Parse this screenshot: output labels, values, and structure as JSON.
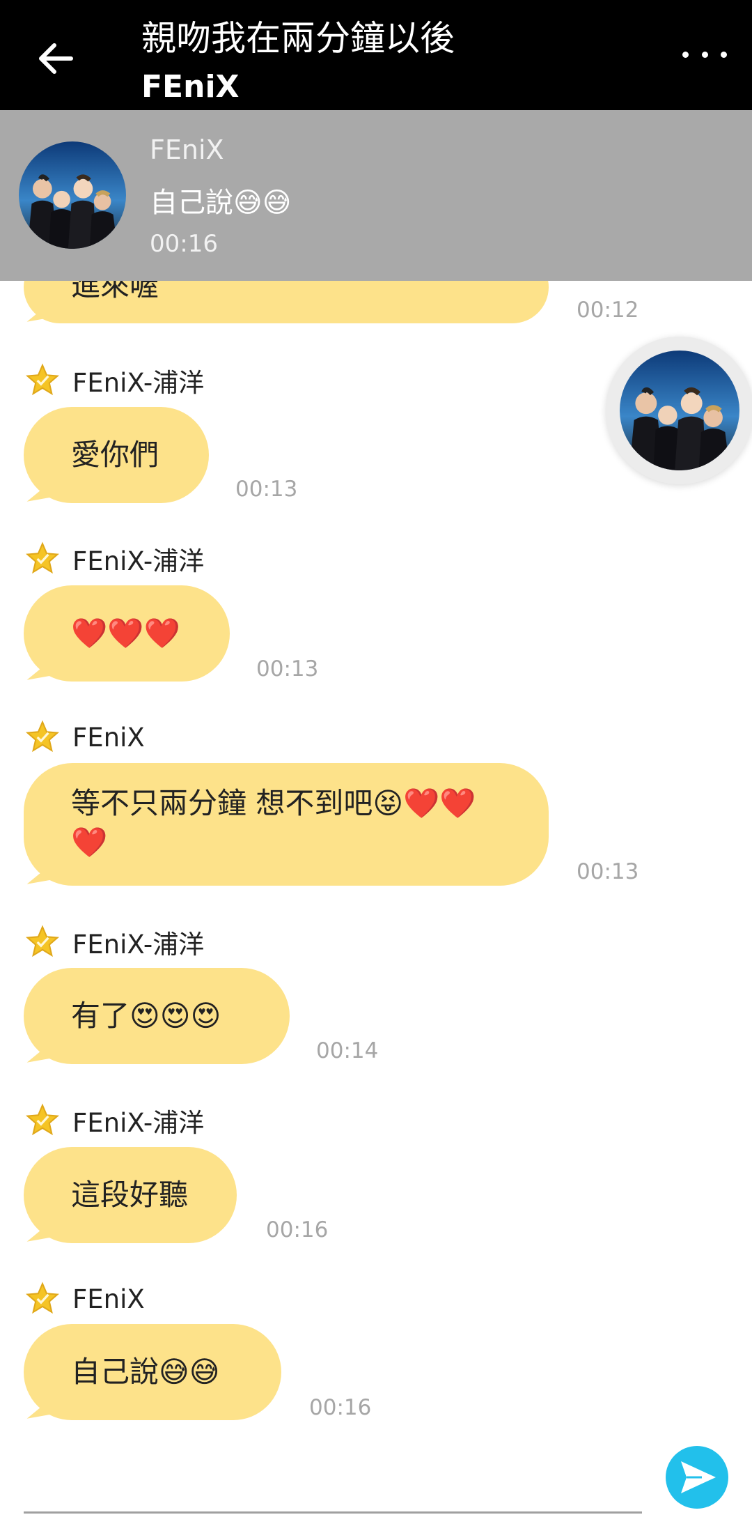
{
  "header": {
    "title": "親吻我在兩分鐘以後",
    "subtitle": "FEniX"
  },
  "pinned": {
    "name": "FEniX",
    "text": "自己說😅😅",
    "time": "00:16"
  },
  "messages": [
    {
      "sender": "",
      "text": "進來喔",
      "time": "00:12"
    },
    {
      "sender": "FEniX-浦洋",
      "text": "愛你們",
      "time": "00:13"
    },
    {
      "sender": "FEniX-浦洋",
      "text": "❤️❤️❤️",
      "time": "00:13"
    },
    {
      "sender": "FEniX",
      "line1": "等不只兩分鐘 想不到吧😝❤️❤️",
      "line2": "❤️",
      "time": "00:13"
    },
    {
      "sender": "FEniX-浦洋",
      "text": "有了😍😍😍",
      "time": "00:14"
    },
    {
      "sender": "FEniX-浦洋",
      "text": "這段好聽",
      "time": "00:16"
    },
    {
      "sender": "FEniX",
      "text": "自己說😅😅",
      "time": "00:16"
    }
  ],
  "icons": {
    "back": "arrow-left-icon",
    "more": "more-horizontal-icon",
    "star": "star-icon",
    "send": "send-icon"
  },
  "colors": {
    "header_bg": "#000000",
    "pinned_bg": "#a9a9a9",
    "bubble": "#fde28a",
    "send": "#22c0eb",
    "star": "#f5c425"
  }
}
